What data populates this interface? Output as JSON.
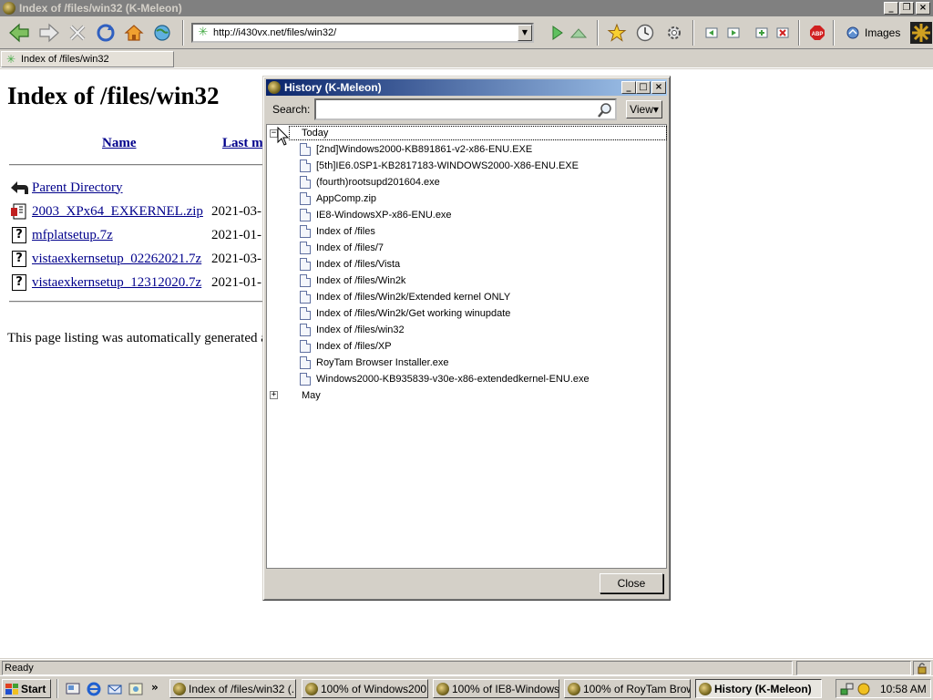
{
  "window": {
    "title": "Index of /files/win32 (K-Meleon)"
  },
  "toolbar": {
    "url": "http://i430vx.net/files/win32/",
    "images_label": "Images"
  },
  "tab": {
    "title": "Index of /files/win32"
  },
  "page": {
    "heading": "Index of /files/win32",
    "col_name": "Name",
    "col_last_modified": "Last m",
    "parent_directory": "Parent Directory",
    "files": [
      {
        "name": "2003_XPx64_EXKERNEL.zip",
        "date": "2021-03-",
        "icon": "archive-icon"
      },
      {
        "name": "mfplatsetup.7z",
        "date": "2021-01-",
        "icon": "unknown-file-icon"
      },
      {
        "name": "vistaexkernsetup_02262021.7z",
        "date": "2021-03-",
        "icon": "unknown-file-icon"
      },
      {
        "name": "vistaexkernsetup_12312020.7z",
        "date": "2021-01-",
        "icon": "unknown-file-icon"
      }
    ],
    "footer": "This page listing was automatically generated a"
  },
  "history_dialog": {
    "title": "History (K-Meleon)",
    "search_label": "Search:",
    "search_value": "",
    "view_label": "View",
    "today_label": "Today",
    "may_label": "May",
    "today_expander": "−",
    "may_expander": "+",
    "items": [
      "[2nd]Windows2000-KB891861-v2-x86-ENU.EXE",
      "[5th]IE6.0SP1-KB2817183-WINDOWS2000-X86-ENU.EXE",
      "(fourth)rootsupd201604.exe",
      "AppComp.zip",
      "IE8-WindowsXP-x86-ENU.exe",
      "Index of /files",
      "Index of /files/7",
      "Index of /files/Vista",
      "Index of /files/Win2k",
      "Index of /files/Win2k/Extended kernel ONLY",
      "Index of /files/Win2k/Get working winupdate",
      "Index of /files/win32",
      "Index of /files/XP",
      "RoyTam Browser Installer.exe",
      "Windows2000-KB935839-v30e-x86-extendedkernel-ENU.exe"
    ],
    "close_label": "Close"
  },
  "statusbar": {
    "text": "Ready"
  },
  "taskbar": {
    "start_label": "Start",
    "tasks": [
      "Index of /files/win32 (...",
      "100% of Windows200...",
      "100% of IE8-Windows...",
      "100% of RoyTam Brow...",
      "History (K-Meleon)"
    ],
    "clock": "10:58 AM"
  },
  "colors": {
    "active_title_start": "#0a246a",
    "active_title_end": "#a6caf0",
    "inactive_title": "#808080",
    "link": "#00008b",
    "face": "#d4d0c8"
  }
}
